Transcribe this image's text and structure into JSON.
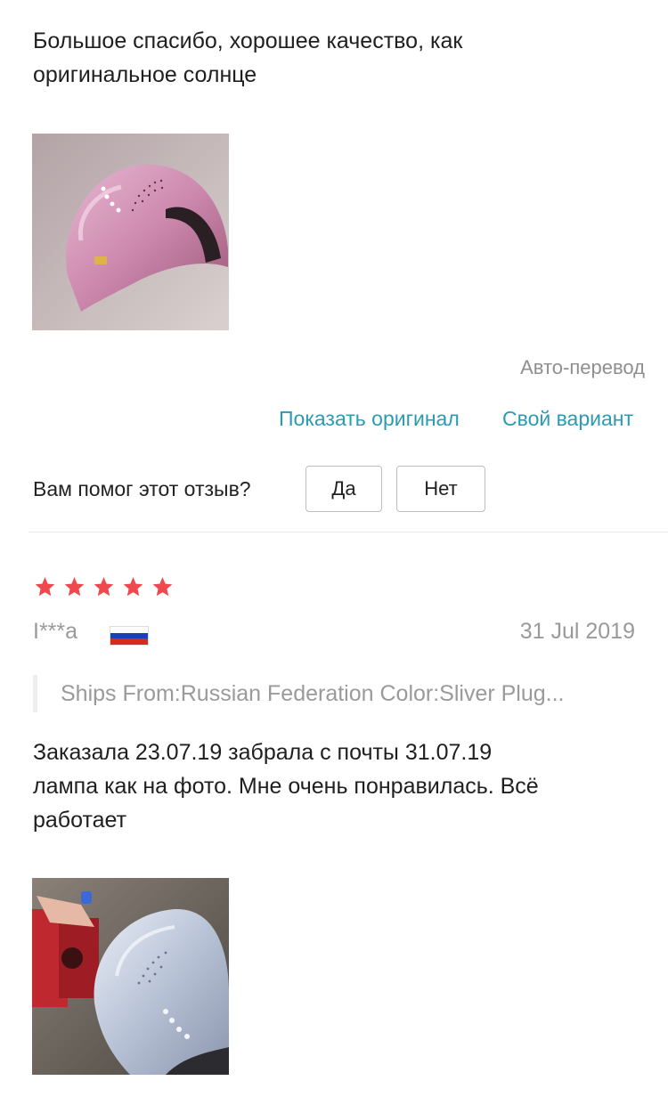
{
  "review_1": {
    "header_cut_text": "",
    "text": "Большое спасибо, хорошее качество, как\nоригинальное солнце",
    "photo_icon": "pink-uv-lamp-photo",
    "auto_translate_label": "Авто-перевод",
    "show_original_link": "Показать оригинал",
    "own_variant_link": "Свой вариант",
    "helpful_question": "Вам помог этот отзыв?",
    "yes_button": "Да",
    "no_button": "Нет"
  },
  "review_2": {
    "rating": 5,
    "star_color": "#f0484f",
    "author": "I***a",
    "country_flag_icon": "russia-flag-icon",
    "date": "31 Jul 2019",
    "sku_info": "Ships From:Russian Federation Color:Sliver Plug...",
    "text": "Заказала 23.07.19 забрала с почты 31.07.19\nлампа как на фото. Мне очень понравилась. Всё\nработает",
    "photo_icon": "silver-uv-lamp-photo"
  },
  "colors": {
    "link": "#2b9bb3",
    "muted_text": "#8f8f8f",
    "flag_white": "#ffffff",
    "flag_blue": "#1a3fb8",
    "flag_red": "#d52b1e"
  }
}
